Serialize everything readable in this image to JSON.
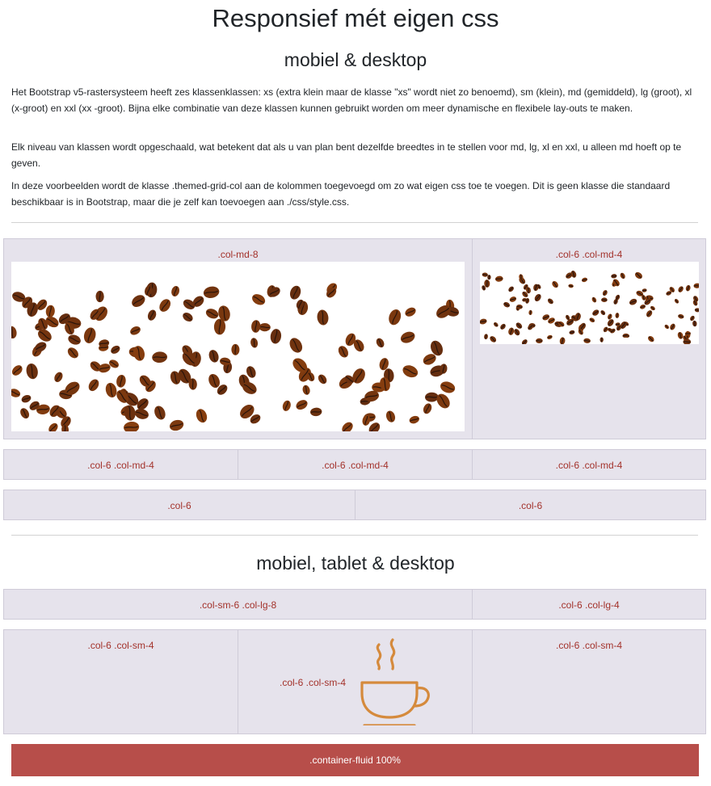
{
  "page": {
    "title": "Responsief mét eigen css",
    "section1_heading": "mobiel & desktop",
    "paragraphs": [
      "Het Bootstrap v5-rastersysteem heeft zes klassenklassen: xs (extra klein maar de klasse \"xs\" wordt niet zo benoemd), sm (klein), md (gemiddeld), lg (groot), xl (x-groot) en xxl (xx -groot). Bijna elke combinatie van deze klassen kunnen gebruikt worden om meer dynamische en flexibele lay-outs te maken.",
      "Elk niveau van klassen wordt opgeschaald, wat betekent dat als u van plan bent dezelfde breedtes in te stellen voor md, lg, xl en xxl, u alleen md hoeft op te geven.",
      "In deze voorbeelden wordt de klasse .themed-grid-col aan de kolommen toegevoegd om zo wat eigen css toe te voegen. Dit is geen klasse die standaard beschikbaar is in Bootstrap, maar die je zelf kan toevoegen aan ./css/style.css."
    ],
    "section2_heading": "mobiel, tablet & desktop"
  },
  "row1": [
    "col-md-8",
    "col-6 col-md-4"
  ],
  "row2": [
    "col-6 col-md-4",
    "col-6 col-md-4",
    "col-6 col-md-4"
  ],
  "row3": [
    "col-6",
    "col-6"
  ],
  "row4": [
    "col-sm-6 col-lg-8",
    "col-6 col-lg-4"
  ],
  "row5": [
    "col-6 col-sm-4",
    "col-6 col-sm-4",
    "col-6 col-sm-4"
  ],
  "fluid_label": ".container-fluid 100%",
  "colors": {
    "cell_bg": "#e6e3ec",
    "cell_text": "#a3322b",
    "fluid_bg": "#b74e4a",
    "cup": "#d58a3c",
    "bean": "#5a2d18"
  },
  "icons": [
    "coffee-beans-image",
    "coffee-cup-icon"
  ]
}
